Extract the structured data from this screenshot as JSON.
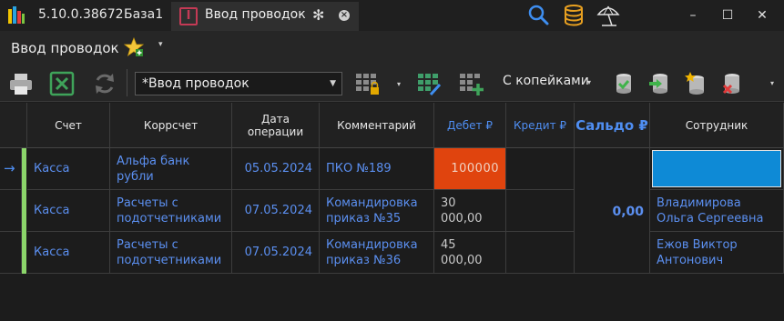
{
  "titlebar": {
    "version": "5.10.0.38672",
    "db_name": "База1",
    "doc_tab_label": "Ввод проводок",
    "doc_tab_icon_letter": "I",
    "pin_glyph": "✻",
    "close_glyph": "×",
    "minimize_glyph": "–",
    "maximize_glyph": "☐",
    "win_close_glyph": "✕"
  },
  "menu": {
    "title": "Ввод проводок",
    "dropdown_glyph": "▾"
  },
  "toolbar": {
    "document_select": "*Ввод проводок",
    "select_arrow": "▼",
    "precision_select": "С копейками",
    "dropdown_glyph": "▾",
    "icons": [
      "print-icon",
      "excel-icon",
      "refresh-icon",
      "lock-grid-icon",
      "edit-grid-icon",
      "add-grid-icon",
      "db-green-icon",
      "db-arrow-icon",
      "db-star-icon",
      "db-delete-icon"
    ]
  },
  "colors": {
    "accent_blue": "#4f8ef2",
    "debit_highlight": "#e0440e",
    "selected_cell": "#0e8ad6",
    "row_indicator": "#8bd56a"
  },
  "grid": {
    "headers": {
      "account": "Счет",
      "corr_account": "Коррсчет",
      "date": "Дата операции",
      "comment": "Комментарий",
      "debit": "Дебет ₽",
      "credit": "Кредит ₽",
      "saldo": "Сальдо ₽",
      "employee": "Сотрудник"
    },
    "current_row_marker": "→",
    "saldo_value": "0,00",
    "rows": [
      {
        "account": "Касса",
        "corr_account": "Альфа банк рубли",
        "date": "05.05.2024",
        "comment": "ПКО №189",
        "debit": "100000",
        "credit": "",
        "employee": ""
      },
      {
        "account": "Касса",
        "corr_account": "Расчеты с подотчетниками",
        "date": "07.05.2024",
        "comment": "Командировка приказ №35",
        "debit": "30 000,00",
        "credit": "",
        "employee": "Владимирова Ольга Сергеевна"
      },
      {
        "account": "Касса",
        "corr_account": "Расчеты с подотчетниками",
        "date": "07.05.2024",
        "comment": "Командировка приказ №36",
        "debit": "45 000,00",
        "credit": "",
        "employee": "Ежов Виктор Антонович"
      }
    ]
  }
}
